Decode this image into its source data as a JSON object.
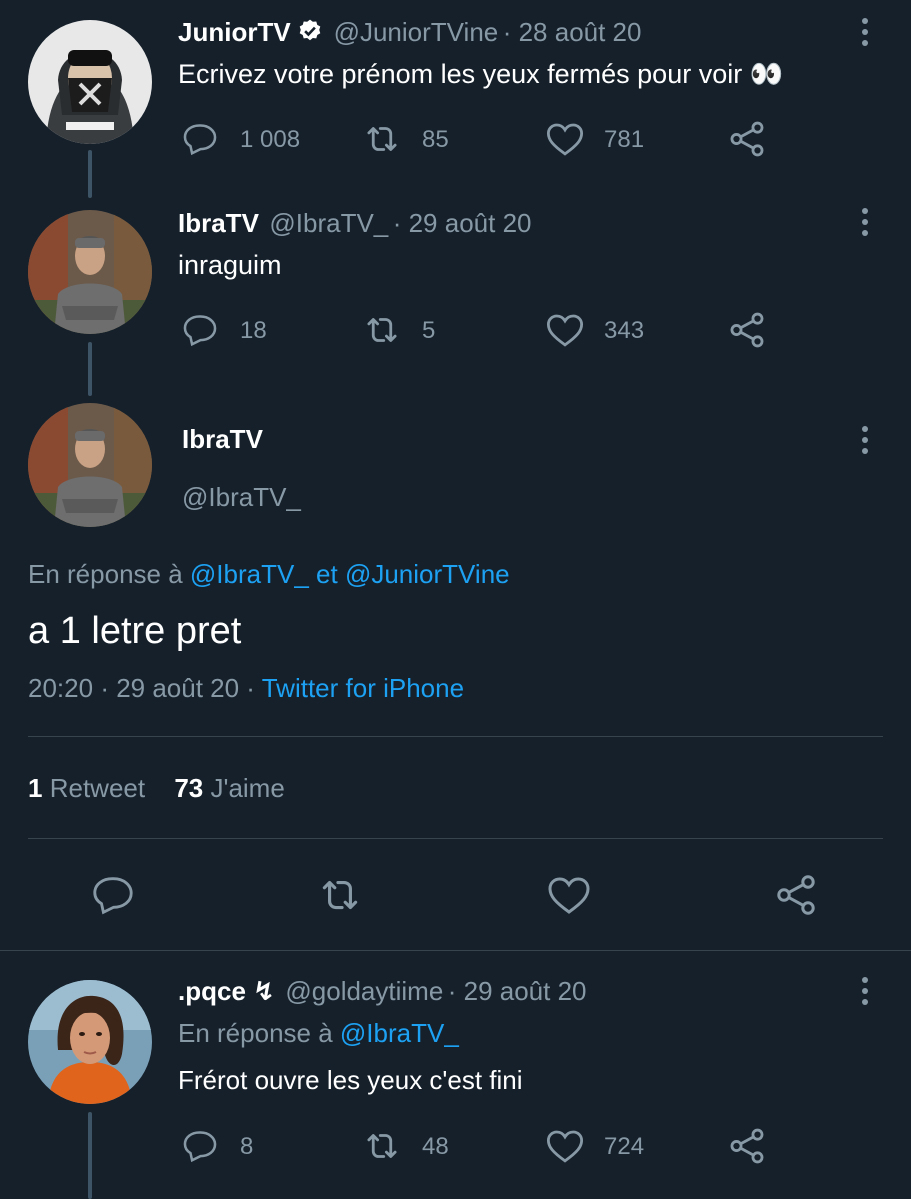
{
  "colors": {
    "background": "#15202b",
    "text_primary": "#ffffff",
    "text_secondary": "#8899a6",
    "link": "#1da1f2",
    "divider": "#38444d",
    "verified": "#ffffff"
  },
  "tweet1": {
    "name": "JuniorTV",
    "verified_icon": "verified-badge-icon",
    "handle": "@JuniorTVine",
    "date": "· 28 août 20",
    "text": "Ecrivez votre prénom les yeux fermés pour voir 👀",
    "replies": "1 008",
    "retweets": "85",
    "likes": "781"
  },
  "tweet2": {
    "name": "IbraTV",
    "handle": "@IbraTV_",
    "date": "· 29 août 20",
    "text": "inraguim",
    "replies": "18",
    "retweets": "5",
    "likes": "343"
  },
  "main": {
    "name": "IbraTV",
    "handle": "@IbraTV_",
    "reply_prefix": "En réponse à",
    "reply_user1": "@IbraTV_",
    "reply_and": "et",
    "reply_user2": "@JuniorTVine",
    "text": "a 1 letre pret",
    "time": "20:20",
    "date": "· 29 août 20 ·",
    "source": "Twitter for iPhone",
    "retweet_count": "1",
    "retweet_label": "Retweet",
    "like_count": "73",
    "like_label": "J'aime"
  },
  "tweet3": {
    "name": ".pqce ↯",
    "handle": "@goldaytiime",
    "date": "· 29 août 20",
    "reply_prefix": "En réponse à",
    "reply_user": "@IbraTV_",
    "text": "Frérot ouvre les yeux c'est fini",
    "replies": "8",
    "retweets": "48",
    "likes": "724"
  },
  "icons": [
    "reply-icon",
    "retweet-icon",
    "like-icon",
    "share-icon",
    "more-icon",
    "verified-badge-icon"
  ]
}
